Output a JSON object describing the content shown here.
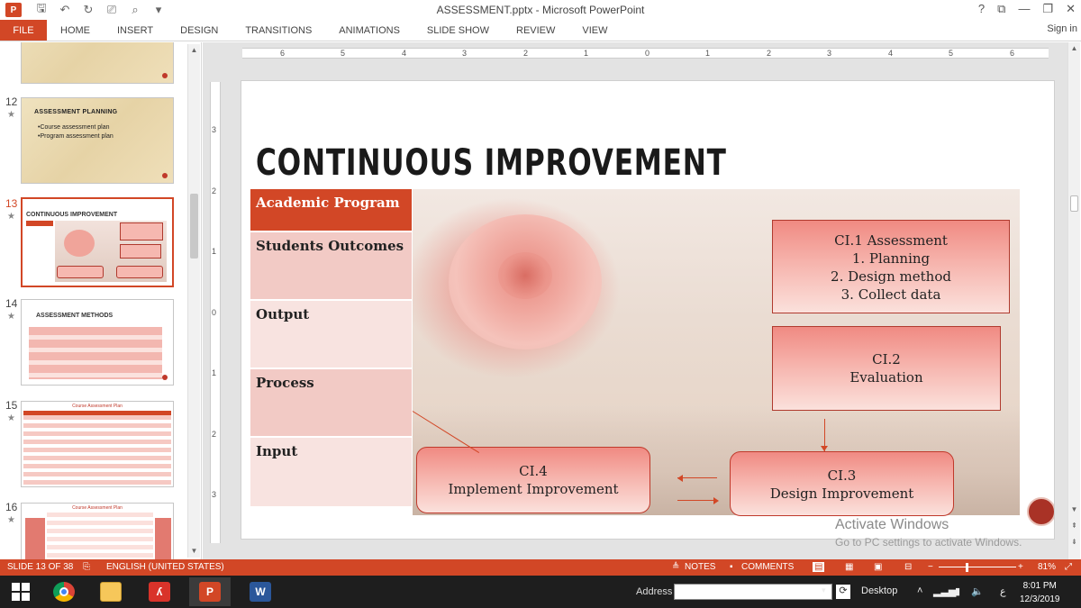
{
  "window": {
    "doc_title": "ASSESSMENT.pptx - Microsoft PowerPoint",
    "app_badge": "P",
    "controls": [
      "?",
      "⧉",
      "—",
      "❐",
      "✕"
    ]
  },
  "ribbon": {
    "file_tab": "FILE",
    "tabs": [
      "HOME",
      "INSERT",
      "DESIGN",
      "TRANSITIONS",
      "ANIMATIONS",
      "SLIDE SHOW",
      "REVIEW",
      "VIEW"
    ],
    "sign_in": "Sign in"
  },
  "thumbnails": [
    {
      "num": "12",
      "title": "ASSESSMENT PLANNING",
      "bullets": [
        "•Course assessment plan",
        "•Program assessment plan"
      ]
    },
    {
      "num": "13",
      "title": "CONTINUOUS IMPROVEMENT"
    },
    {
      "num": "14",
      "title": "ASSESSMENT METHODS"
    },
    {
      "num": "15",
      "title": "Course Assessment Plan"
    },
    {
      "num": "16",
      "title": "Course Assessment Plan"
    }
  ],
  "rulers": {
    "horizontal": [
      "6",
      "5",
      "4",
      "3",
      "2",
      "1",
      "0",
      "1",
      "2",
      "3",
      "4",
      "5",
      "6"
    ],
    "vertical": [
      "3",
      "2",
      "1",
      "0",
      "1",
      "2",
      "3"
    ]
  },
  "slide": {
    "title": "CONTINUOUS IMPROVEMENT",
    "left_column": {
      "header": "Academic Program",
      "rows": [
        "Students Outcomes",
        "Output",
        "Process",
        "Input"
      ]
    },
    "ci1": {
      "title": "CI.1 Assessment",
      "items": [
        "1.  Planning",
        "2.  Design method",
        "3.  Collect data"
      ]
    },
    "ci2": {
      "title": "CI.2",
      "subtitle": "Evaluation"
    },
    "ci3": {
      "title": "CI.3",
      "subtitle": "Design Improvement"
    },
    "ci4": {
      "title": "CI.4",
      "subtitle": "Implement Improvement"
    }
  },
  "watermark": {
    "title": "Activate Windows",
    "subtitle": "Go to PC settings to activate Windows."
  },
  "status": {
    "slide_info": "SLIDE 13 OF 38",
    "language": "ENGLISH (UNITED STATES)",
    "notes": "NOTES",
    "comments": "COMMENTS",
    "zoom": "81%",
    "zoom_level": 0.81
  },
  "taskbar": {
    "address_label": "Address",
    "address_value": "",
    "desktop_label": "Desktop",
    "tray_lang": "ع",
    "time": "8:01 PM",
    "date": "12/3/2019"
  }
}
